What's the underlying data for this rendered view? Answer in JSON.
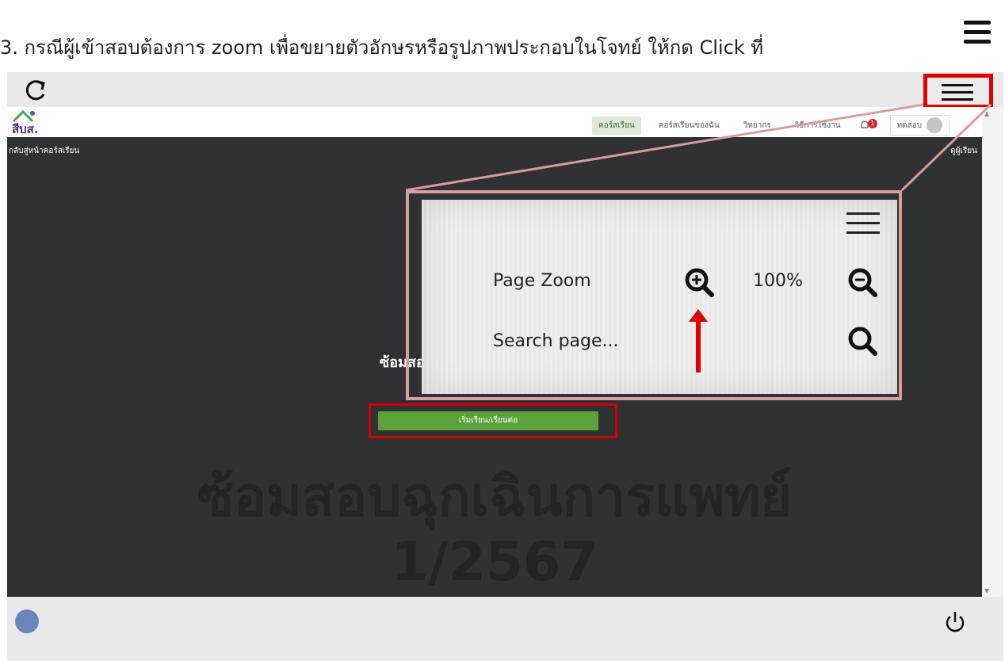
{
  "instruction": {
    "text": "3. กรณีผู้เข้าสอบต้องการ zoom เพื่อขยายตัวอักษรหรือรูปภาพประกอบในโจทย์ ให้กด Click ที่"
  },
  "site": {
    "logo": "สีบส.",
    "nav": [
      "คอร์สเรียน",
      "คอร์สเรียนของฉัน",
      "วิทยากร",
      "วิธีการใช้งาน"
    ],
    "notification_count": "1",
    "user_name": "ทดสอบ",
    "back_link": "กลับสู่หน้าคอร์สเรียน",
    "right_link": "ดูผู้เรียน",
    "course_short_title": "ซ้อมสอ",
    "start_button": "เริ่มเรียน/เรียนต่อ",
    "background_title_line1": "ซ้อมสอบฉุกเฉินการแพทย์",
    "background_title_line2": "1/2567"
  },
  "zoom_panel": {
    "page_zoom_label": "Page Zoom",
    "zoom_level": "100%",
    "search_label": "Search page..."
  },
  "icons": {
    "reload": "reload-icon",
    "menu": "menu-icon",
    "zoom_in": "zoom-in-icon",
    "zoom_out": "zoom-out-icon",
    "search": "search-icon",
    "globe": "globe-icon",
    "power": "power-icon",
    "bell": "bell-icon",
    "avatar": "avatar-icon"
  },
  "colors": {
    "highlight_red": "#d40000",
    "callout_pink": "#d99ca0",
    "start_green": "#5aa33a",
    "site_dark": "#2f3133"
  }
}
